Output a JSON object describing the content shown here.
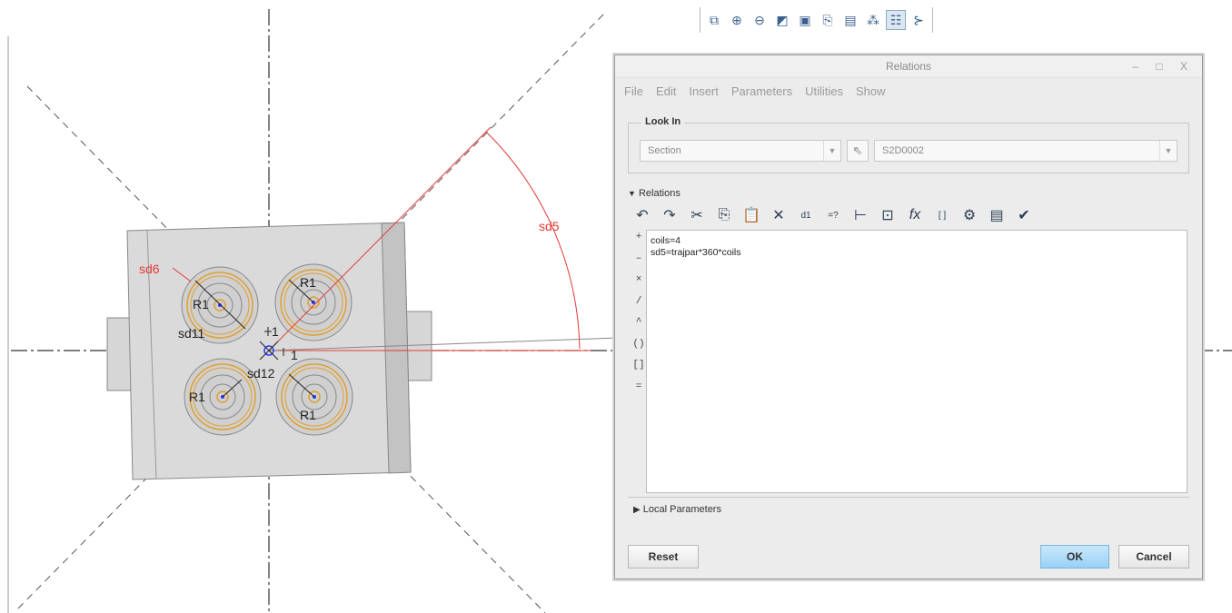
{
  "sketch": {
    "labels": {
      "sd5": "sd5",
      "sd6": "sd6",
      "sd11": "sd11",
      "sd12": "sd12",
      "r_tl": "R1",
      "r_tr": "R1",
      "r_bl": "R1",
      "r_br": "R1",
      "one_a": "1",
      "one_b": "1"
    },
    "colors": {
      "dimension": "#e53935",
      "part_fill": "#d9d9d9",
      "construction": "#333333",
      "spring": "#e0a030"
    }
  },
  "view_toolbar": {
    "icons": [
      "refit-icon",
      "zoom-in-icon",
      "zoom-out-icon",
      "repaint-icon",
      "display-style-icon",
      "saved-orientations-icon",
      "view-manager-icon",
      "datum-display-icon",
      "sketch-display-icon",
      "sketcher-display-icon"
    ],
    "glyphs": [
      "⧉",
      "⊕",
      "⊖",
      "◩",
      "▣",
      "⎘",
      "▤",
      "⁂",
      "☷",
      "⊱"
    ]
  },
  "dialog": {
    "title": "Relations",
    "win_controls": "– □ X",
    "menu": [
      "File",
      "Edit",
      "Insert",
      "Parameters",
      "Utilities",
      "Show"
    ],
    "look_in": {
      "legend": "Look In",
      "type_value": "Section",
      "item_value": "S2D0002"
    },
    "relations_header": "Relations",
    "toolbar_glyphs": [
      "↶",
      "↷",
      "✂",
      "⎘",
      "📋",
      "✕",
      "d1",
      "=?",
      "⊢",
      "⊡",
      "fx",
      "[ ]",
      "⚙",
      "▤",
      "✔"
    ],
    "toolbar_icons": [
      "undo-icon",
      "redo-icon",
      "cut-icon",
      "copy-icon",
      "paste-icon",
      "delete-icon",
      "switch-dims-icon",
      "evaluate-icon",
      "insert-dimension-icon",
      "display-icon",
      "insert-function-icon",
      "brackets-icon",
      "unit-sensitive-icon",
      "sort-icon",
      "verify-icon"
    ],
    "operators": [
      "+",
      "–",
      "×",
      "/",
      "^",
      "()",
      "[]",
      "="
    ],
    "relations_text": [
      "coils=4",
      "sd5=trajpar*360*coils"
    ],
    "local_parameters": "Local Parameters",
    "buttons": {
      "reset": "Reset",
      "ok": "OK",
      "cancel": "Cancel"
    }
  }
}
